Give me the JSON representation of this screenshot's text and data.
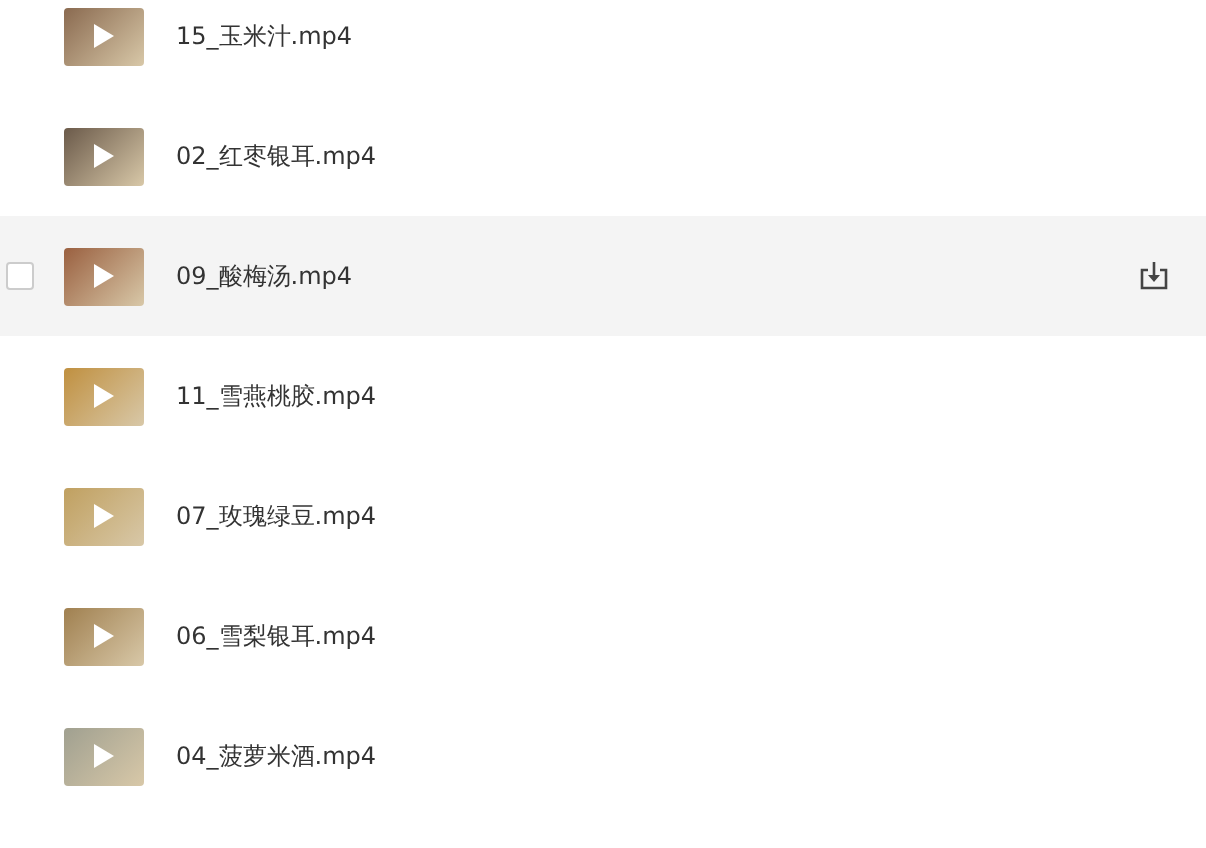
{
  "files": [
    {
      "name": "15_玉米汁.mp4",
      "hovered": false
    },
    {
      "name": "02_红枣银耳.mp4",
      "hovered": false
    },
    {
      "name": "09_酸梅汤.mp4",
      "hovered": true,
      "checked": false
    },
    {
      "name": "11_雪燕桃胶.mp4",
      "hovered": false
    },
    {
      "name": "07_玫瑰绿豆.mp4",
      "hovered": false
    },
    {
      "name": "06_雪梨银耳.mp4",
      "hovered": false
    },
    {
      "name": "04_菠萝米酒.mp4",
      "hovered": false
    }
  ]
}
